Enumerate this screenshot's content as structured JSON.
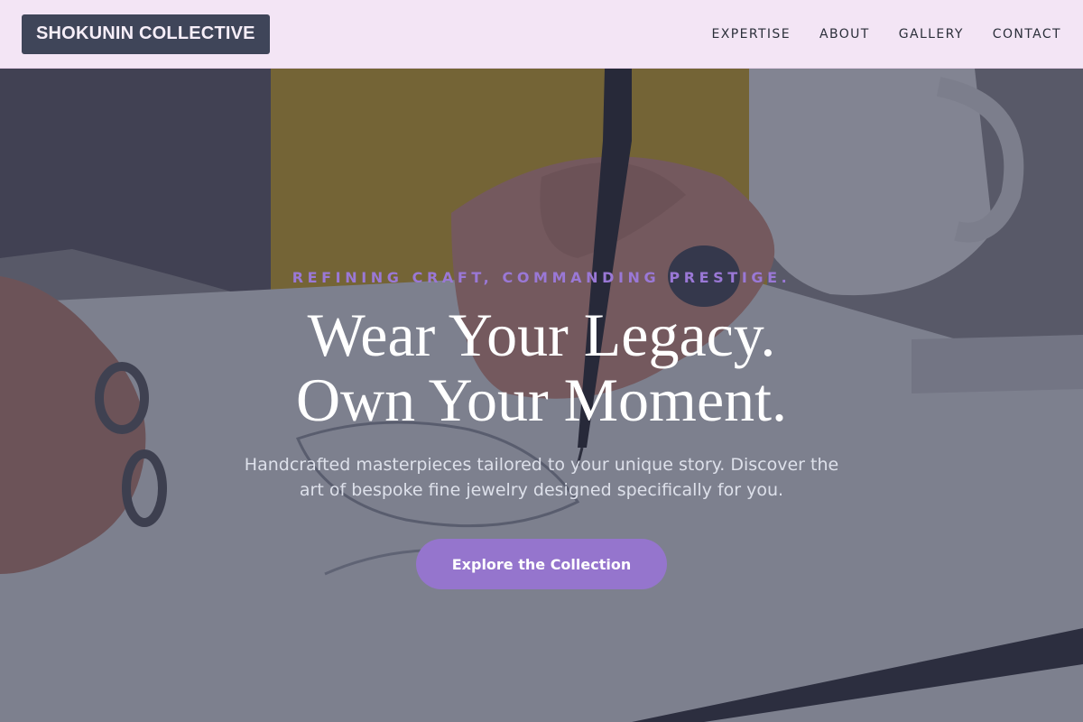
{
  "header": {
    "logo": "SHOKUNIN COLLECTIVE",
    "nav": [
      "EXPERTISE",
      "ABOUT",
      "GALLERY",
      "CONTACT"
    ]
  },
  "hero": {
    "tagline": "REFINING CRAFT, COMMANDING PRESTIGE.",
    "headline_line1": "Wear Your Legacy.",
    "headline_line2": "Own Your Moment.",
    "subtext": "Handcrafted masterpieces tailored to your unique story. Discover the art of bespoke fine jewelry designed specifically for you.",
    "cta_label": "Explore the Collection"
  },
  "colors": {
    "header_bg": "#f3e5f5",
    "logo_bg": "#3f4559",
    "accent": "#9575cd",
    "overlay": "#2d3248"
  }
}
